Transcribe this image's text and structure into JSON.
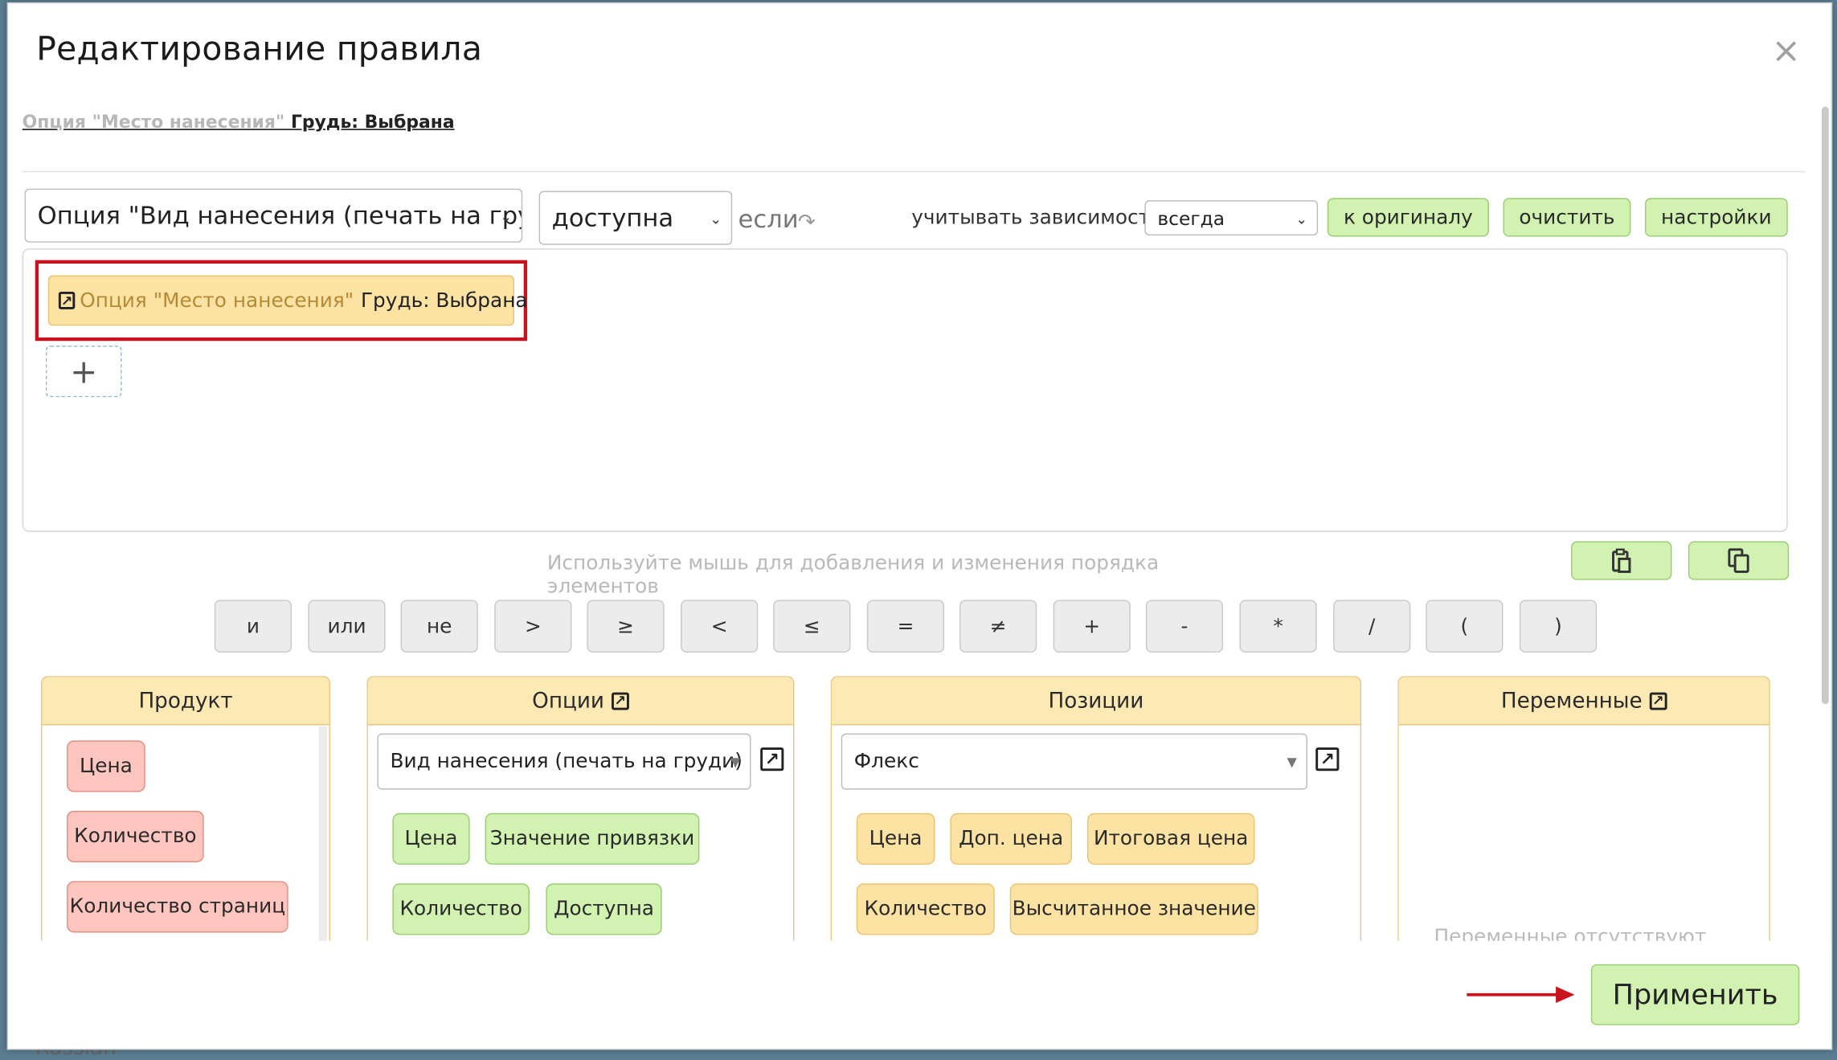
{
  "dialog": {
    "title": "Редактирование правила",
    "close_glyph": "×",
    "breadcrumb_prefix": "Опция \"Место нанесения\"",
    "breadcrumb_value": " Грудь: Выбрана"
  },
  "toolbar": {
    "target_select": "Опция \"Вид нанесения (печать на гру,",
    "state_select": "доступна",
    "if_label": "если",
    "dependency_label": "учитывать зависимости",
    "dependency_select": "всегда",
    "to_original": "к оригиналу",
    "clear": "очистить",
    "settings": "настройки"
  },
  "rule": {
    "condition_prefix": "Опция \"Место нанесения\"",
    "condition_value": "Грудь: Выбрана",
    "add_glyph": "+"
  },
  "hint": "Используйте мышь для добавления и изменения порядка элементов",
  "operators": [
    "и",
    "или",
    "не",
    ">",
    "≥",
    "<",
    "≤",
    "=",
    "≠",
    "+",
    "-",
    "*",
    "/",
    "(",
    ")"
  ],
  "panels": {
    "product": {
      "title": "Продукт",
      "items": [
        "Цена",
        "Количество",
        "Количество страниц"
      ]
    },
    "options": {
      "title": "Опции",
      "select": "Вид нанесения (печать на груди)",
      "items": [
        "Цена",
        "Значение привязки",
        "Количество",
        "Доступна"
      ]
    },
    "positions": {
      "title": "Позиции",
      "select": "Флекс",
      "items": [
        "Цена",
        "Доп. цена",
        "Итоговая цена",
        "Количество",
        "Высчитанное значение"
      ]
    },
    "variables": {
      "title": "Переменные",
      "empty": "Переменные отсутствуют"
    }
  },
  "apply": "Применить",
  "taskbar": {
    "language": "Russian"
  },
  "colors": {
    "green_button": "#d2f2b2",
    "yellow_chip": "#fde3a3",
    "red_chip": "#ffc6c0",
    "highlight_frame": "#c8141e"
  }
}
